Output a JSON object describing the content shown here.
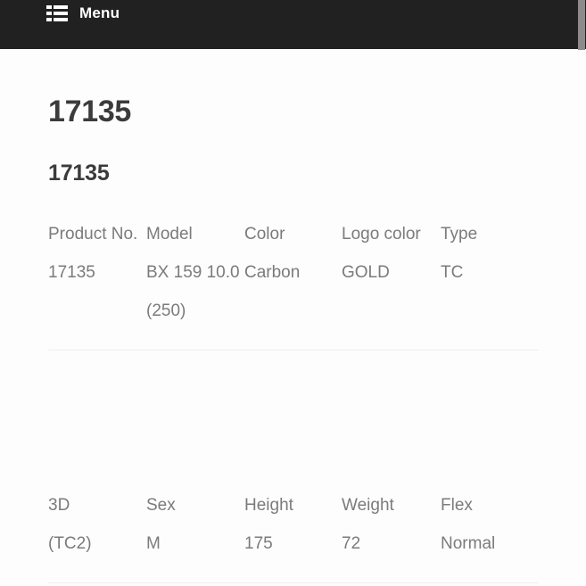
{
  "header": {
    "menu_label": "Menu",
    "menu_icon": "list-icon",
    "background_color": "#212121",
    "text_color": "#fefefe"
  },
  "scrollbar": {
    "thumb_color": "#8b8b8b"
  },
  "page": {
    "title": "17135",
    "section_title": "17135",
    "background_color": "#fdfdfd",
    "heading_color": "#3b3b3b",
    "table_text_color": "#7b7b7b",
    "divider_color": "#efefef"
  },
  "tables": [
    {
      "name": "product-spec-table",
      "headers": [
        "Product No.",
        "Model",
        "Color",
        "Logo color",
        "Type"
      ],
      "rows": [
        [
          "17135",
          "BX 159 10.0 (250)",
          "Carbon",
          "GOLD",
          "TC"
        ]
      ]
    },
    {
      "name": "fitting-spec-table",
      "headers": [
        "3D",
        "Sex",
        "Height",
        "Weight",
        "Flex"
      ],
      "rows": [
        [
          "(TC2)",
          "M",
          "175",
          "72",
          "Normal"
        ]
      ]
    }
  ]
}
